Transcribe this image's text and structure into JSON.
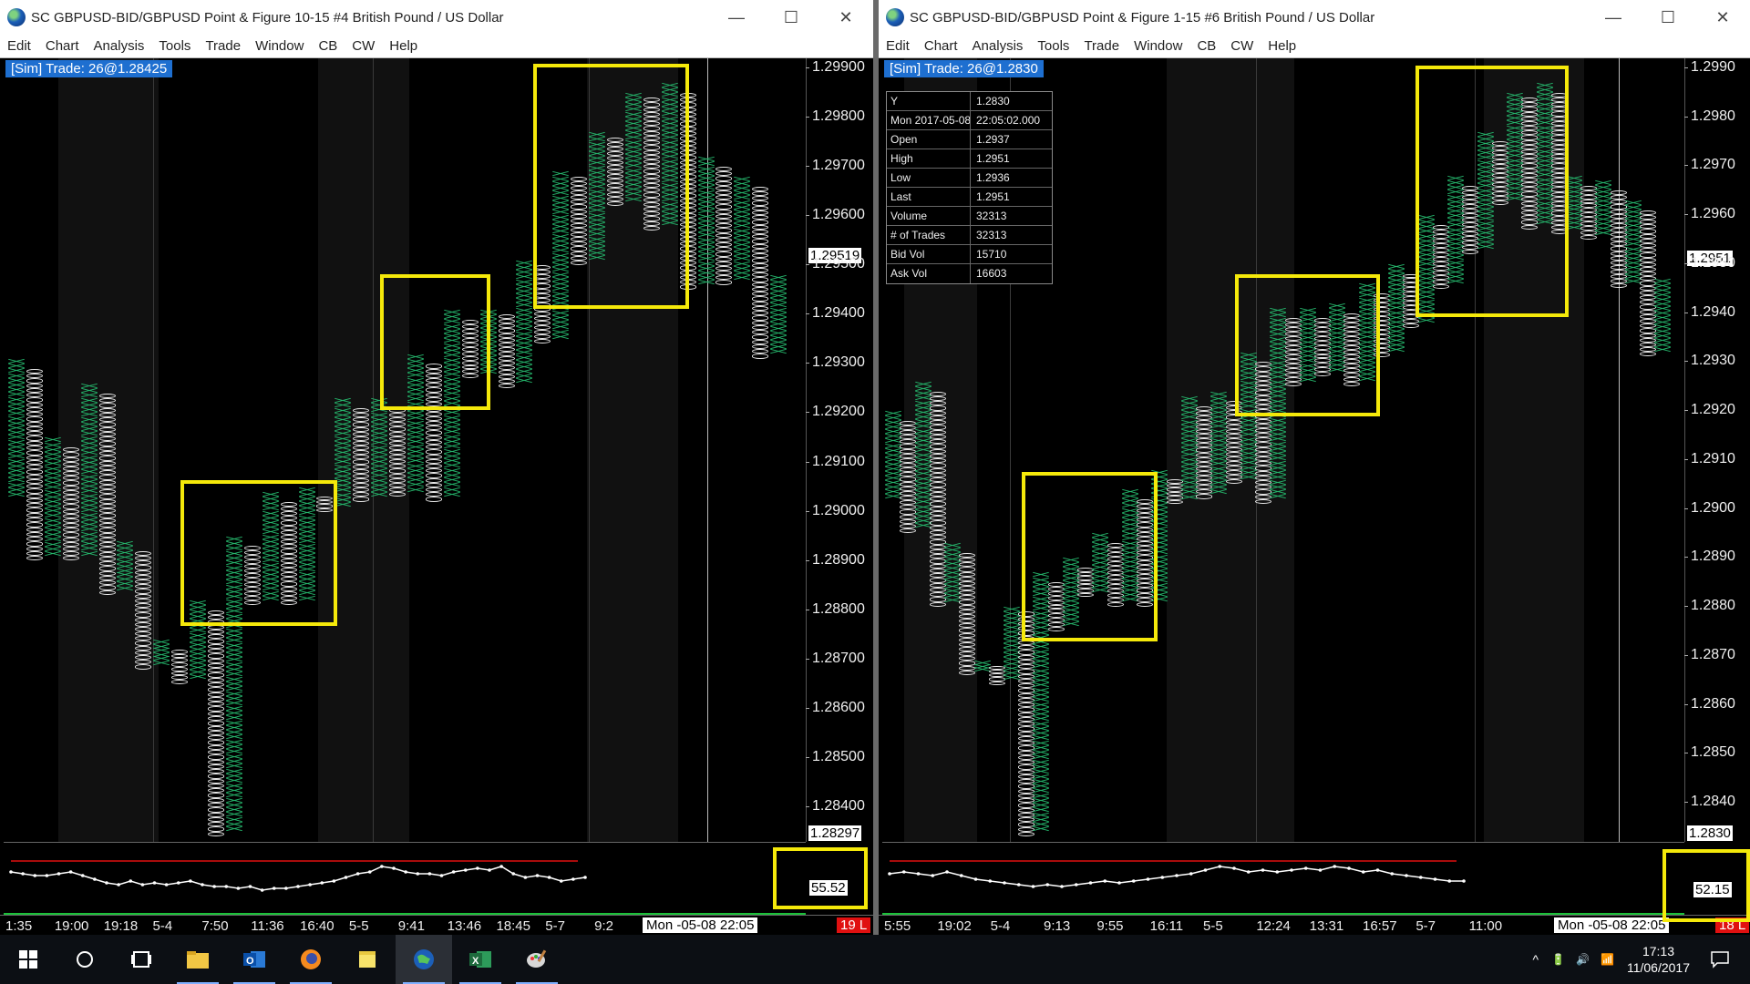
{
  "colors": {
    "x_box": "#25b56b",
    "o_box": "#e8e8e8",
    "highlight": "#f5e90a",
    "sim_label_bg": "#1e6fd0",
    "osc_upper_line": "#e01010",
    "osc_lower_line": "#1cc13a"
  },
  "icons": {
    "title_app_icon": "globe-icon",
    "minimize": "minimize-icon",
    "maximize": "maximize-icon",
    "close": "close-icon"
  },
  "menu": [
    "Edit",
    "Chart",
    "Analysis",
    "Tools",
    "Trade",
    "Window",
    "CB",
    "CW",
    "Help"
  ],
  "title_controls": {
    "minimize": "—",
    "maximize": "☐",
    "close": "✕"
  },
  "windows": {
    "left": {
      "title": "SC GBPUSD-BID/GBPUSD  Point & Figure 10-15  #4  British Pound / US Dollar",
      "sim_label": "[Sim]  Trade: 26@1.28425",
      "price_ticks": [
        "1.29900",
        "1.29800",
        "1.29700",
        "1.29600",
        "1.29500",
        "1.29400",
        "1.29300",
        "1.29200",
        "1.29100",
        "1.29000",
        "1.28900",
        "1.28800",
        "1.28700",
        "1.28600",
        "1.28500",
        "1.28400"
      ],
      "current_price": "1.29519",
      "last_price": "1.28297",
      "osc_value": "55.52",
      "time_labels": [
        "1:35",
        "19:00",
        "19:18",
        "5-4",
        "7:50",
        "11:36",
        "16:40",
        "5-5",
        "9:41",
        "13:46",
        "18:45",
        "5-7",
        "9:2"
      ],
      "date_info": "Mon -05-08  22:05",
      "bars_badge": "19 L"
    },
    "right": {
      "title": "SC GBPUSD-BID/GBPUSD  Point & Figure 1-15  #6  British Pound / US Dollar",
      "sim_label": "[Sim]  Trade: 26@1.2830",
      "price_ticks": [
        "1.2990",
        "1.2980",
        "1.2970",
        "1.2960",
        "1.2950",
        "1.2940",
        "1.2930",
        "1.2920",
        "1.2910",
        "1.2900",
        "1.2890",
        "1.2880",
        "1.2870",
        "1.2860",
        "1.2850",
        "1.2840"
      ],
      "current_price": "1.2951",
      "last_price": "1.2830",
      "osc_value": "52.15",
      "time_labels": [
        "5:55",
        "19:02",
        "5-4",
        "9:13",
        "9:55",
        "16:11",
        "5-5",
        "12:24",
        "13:31",
        "16:57",
        "5-7",
        "11:00"
      ],
      "date_info": "Mon -05-08  22:05",
      "bars_badge": "18 L",
      "data_window": [
        {
          "k": "Y",
          "v": "1.2830"
        },
        {
          "k": "Mon 2017-05-08",
          "v": "22:05:02.000"
        },
        {
          "k": "Open",
          "v": "1.2937"
        },
        {
          "k": "High",
          "v": "1.2951"
        },
        {
          "k": "Low",
          "v": "1.2936"
        },
        {
          "k": "Last",
          "v": "1.2951"
        },
        {
          "k": "Volume",
          "v": "32313"
        },
        {
          "k": "# of Trades",
          "v": "32313"
        },
        {
          "k": "Bid Vol",
          "v": "15710"
        },
        {
          "k": "Ask Vol",
          "v": "16603"
        }
      ]
    }
  },
  "chart_data": [
    {
      "type": "point-and-figure",
      "box_size": 0.0001,
      "ylim": [
        1.2833,
        1.2992
      ],
      "columns": [
        {
          "t": "X",
          "lo": 1.2903,
          "hi": 1.2931
        },
        {
          "t": "O",
          "lo": 1.289,
          "hi": 1.2929
        },
        {
          "t": "X",
          "lo": 1.2891,
          "hi": 1.2915
        },
        {
          "t": "O",
          "lo": 1.289,
          "hi": 1.2913
        },
        {
          "t": "X",
          "lo": 1.2891,
          "hi": 1.2926
        },
        {
          "t": "O",
          "lo": 1.2883,
          "hi": 1.2924
        },
        {
          "t": "X",
          "lo": 1.2884,
          "hi": 1.2894
        },
        {
          "t": "O",
          "lo": 1.2868,
          "hi": 1.2892
        },
        {
          "t": "X",
          "lo": 1.2869,
          "hi": 1.2874
        },
        {
          "t": "O",
          "lo": 1.2865,
          "hi": 1.2872
        },
        {
          "t": "X",
          "lo": 1.2866,
          "hi": 1.2882
        },
        {
          "t": "O",
          "lo": 1.2834,
          "hi": 1.288
        },
        {
          "t": "X",
          "lo": 1.2835,
          "hi": 1.2895
        },
        {
          "t": "O",
          "lo": 1.2881,
          "hi": 1.2893
        },
        {
          "t": "X",
          "lo": 1.2882,
          "hi": 1.2904
        },
        {
          "t": "O",
          "lo": 1.2881,
          "hi": 1.2902
        },
        {
          "t": "X",
          "lo": 1.2882,
          "hi": 1.2905
        },
        {
          "t": "O",
          "lo": 1.29,
          "hi": 1.2903
        },
        {
          "t": "X",
          "lo": 1.2901,
          "hi": 1.2923
        },
        {
          "t": "O",
          "lo": 1.2902,
          "hi": 1.2921
        },
        {
          "t": "X",
          "lo": 1.2903,
          "hi": 1.2923
        },
        {
          "t": "O",
          "lo": 1.2903,
          "hi": 1.2921
        },
        {
          "t": "X",
          "lo": 1.2904,
          "hi": 1.2932
        },
        {
          "t": "O",
          "lo": 1.2902,
          "hi": 1.293
        },
        {
          "t": "X",
          "lo": 1.2903,
          "hi": 1.2941
        },
        {
          "t": "O",
          "lo": 1.2927,
          "hi": 1.2939
        },
        {
          "t": "X",
          "lo": 1.2928,
          "hi": 1.2941
        },
        {
          "t": "O",
          "lo": 1.2925,
          "hi": 1.294
        },
        {
          "t": "X",
          "lo": 1.2926,
          "hi": 1.2951
        },
        {
          "t": "O",
          "lo": 1.2934,
          "hi": 1.295
        },
        {
          "t": "X",
          "lo": 1.2935,
          "hi": 1.2969
        },
        {
          "t": "O",
          "lo": 1.295,
          "hi": 1.2968
        },
        {
          "t": "X",
          "lo": 1.2951,
          "hi": 1.2977
        },
        {
          "t": "O",
          "lo": 1.2962,
          "hi": 1.2976
        },
        {
          "t": "X",
          "lo": 1.2963,
          "hi": 1.2985
        },
        {
          "t": "O",
          "lo": 1.2957,
          "hi": 1.2984
        },
        {
          "t": "X",
          "lo": 1.2958,
          "hi": 1.2987
        },
        {
          "t": "O",
          "lo": 1.2945,
          "hi": 1.2985
        },
        {
          "t": "X",
          "lo": 1.2946,
          "hi": 1.2972
        },
        {
          "t": "O",
          "lo": 1.2946,
          "hi": 1.297
        },
        {
          "t": "X",
          "lo": 1.2947,
          "hi": 1.2968
        },
        {
          "t": "O",
          "lo": 1.2931,
          "hi": 1.2966
        },
        {
          "t": "X",
          "lo": 1.2932,
          "hi": 1.2948
        }
      ],
      "oscillator": {
        "values": [
          52,
          51,
          50,
          50,
          51,
          52,
          50,
          48,
          46,
          45,
          47,
          45,
          46,
          45,
          46,
          47,
          45,
          44,
          44,
          43,
          44,
          42,
          43,
          43,
          44,
          45,
          46,
          47,
          49,
          51,
          52,
          55,
          54,
          52,
          51,
          51,
          50,
          52,
          53,
          54,
          53,
          55,
          51,
          49,
          50,
          49,
          47,
          48,
          49
        ],
        "upper_level": 58,
        "lower_level": 0
      }
    },
    {
      "type": "point-and-figure",
      "box_size": 0.0001,
      "ylim": [
        1.2832,
        1.2992
      ],
      "columns": [
        {
          "t": "X",
          "lo": 1.2902,
          "hi": 1.292
        },
        {
          "t": "O",
          "lo": 1.2895,
          "hi": 1.2918
        },
        {
          "t": "X",
          "lo": 1.2896,
          "hi": 1.2926
        },
        {
          "t": "O",
          "lo": 1.288,
          "hi": 1.2924
        },
        {
          "t": "X",
          "lo": 1.2881,
          "hi": 1.2893
        },
        {
          "t": "O",
          "lo": 1.2866,
          "hi": 1.2891
        },
        {
          "t": "X",
          "lo": 1.2867,
          "hi": 1.2869
        },
        {
          "t": "O",
          "lo": 1.2864,
          "hi": 1.2868
        },
        {
          "t": "X",
          "lo": 1.2865,
          "hi": 1.288
        },
        {
          "t": "O",
          "lo": 1.2833,
          "hi": 1.2879
        },
        {
          "t": "X",
          "lo": 1.2834,
          "hi": 1.2887
        },
        {
          "t": "O",
          "lo": 1.2875,
          "hi": 1.2885
        },
        {
          "t": "X",
          "lo": 1.2876,
          "hi": 1.289
        },
        {
          "t": "O",
          "lo": 1.2882,
          "hi": 1.2888
        },
        {
          "t": "X",
          "lo": 1.2883,
          "hi": 1.2895
        },
        {
          "t": "O",
          "lo": 1.288,
          "hi": 1.2893
        },
        {
          "t": "X",
          "lo": 1.2881,
          "hi": 1.2904
        },
        {
          "t": "O",
          "lo": 1.288,
          "hi": 1.2902
        },
        {
          "t": "X",
          "lo": 1.2881,
          "hi": 1.2908
        },
        {
          "t": "O",
          "lo": 1.2901,
          "hi": 1.2906
        },
        {
          "t": "X",
          "lo": 1.2902,
          "hi": 1.2923
        },
        {
          "t": "O",
          "lo": 1.2902,
          "hi": 1.2921
        },
        {
          "t": "X",
          "lo": 1.2903,
          "hi": 1.2924
        },
        {
          "t": "O",
          "lo": 1.2905,
          "hi": 1.2922
        },
        {
          "t": "X",
          "lo": 1.2906,
          "hi": 1.2932
        },
        {
          "t": "O",
          "lo": 1.2901,
          "hi": 1.293
        },
        {
          "t": "X",
          "lo": 1.2902,
          "hi": 1.2941
        },
        {
          "t": "O",
          "lo": 1.2925,
          "hi": 1.2939
        },
        {
          "t": "X",
          "lo": 1.2926,
          "hi": 1.2941
        },
        {
          "t": "O",
          "lo": 1.2927,
          "hi": 1.2939
        },
        {
          "t": "X",
          "lo": 1.2928,
          "hi": 1.2942
        },
        {
          "t": "O",
          "lo": 1.2925,
          "hi": 1.294
        },
        {
          "t": "X",
          "lo": 1.2926,
          "hi": 1.2946
        },
        {
          "t": "O",
          "lo": 1.2931,
          "hi": 1.2944
        },
        {
          "t": "X",
          "lo": 1.2932,
          "hi": 1.295
        },
        {
          "t": "O",
          "lo": 1.2937,
          "hi": 1.2948
        },
        {
          "t": "X",
          "lo": 1.2938,
          "hi": 1.296
        },
        {
          "t": "O",
          "lo": 1.2945,
          "hi": 1.2958
        },
        {
          "t": "X",
          "lo": 1.2946,
          "hi": 1.2968
        },
        {
          "t": "O",
          "lo": 1.2952,
          "hi": 1.2966
        },
        {
          "t": "X",
          "lo": 1.2953,
          "hi": 1.2977
        },
        {
          "t": "O",
          "lo": 1.2962,
          "hi": 1.2975
        },
        {
          "t": "X",
          "lo": 1.2963,
          "hi": 1.2985
        },
        {
          "t": "O",
          "lo": 1.2957,
          "hi": 1.2984
        },
        {
          "t": "X",
          "lo": 1.2958,
          "hi": 1.2987
        },
        {
          "t": "O",
          "lo": 1.2956,
          "hi": 1.2985
        },
        {
          "t": "X",
          "lo": 1.2957,
          "hi": 1.2968
        },
        {
          "t": "O",
          "lo": 1.2955,
          "hi": 1.2966
        },
        {
          "t": "X",
          "lo": 1.2956,
          "hi": 1.2967
        },
        {
          "t": "O",
          "lo": 1.2945,
          "hi": 1.2965
        },
        {
          "t": "X",
          "lo": 1.2946,
          "hi": 1.2963
        },
        {
          "t": "O",
          "lo": 1.2931,
          "hi": 1.2961
        },
        {
          "t": "X",
          "lo": 1.2932,
          "hi": 1.2947
        }
      ],
      "oscillator": {
        "values": [
          51,
          52,
          51,
          50,
          52,
          50,
          48,
          47,
          46,
          45,
          44,
          45,
          44,
          45,
          46,
          47,
          46,
          47,
          48,
          49,
          50,
          51,
          53,
          55,
          54,
          52,
          53,
          52,
          53,
          54,
          53,
          55,
          54,
          52,
          53,
          51,
          50,
          49,
          48,
          47,
          47
        ],
        "upper_level": 58,
        "lower_level": 0
      }
    }
  ],
  "taskbar": {
    "icons": [
      "windows-start-icon",
      "search-circle-icon",
      "task-view-icon",
      "file-explorer-icon",
      "outlook-icon",
      "firefox-icon",
      "sticky-notes-icon",
      "sierra-chart-icon",
      "excel-icon",
      "paint-icon"
    ],
    "active_icon": "sierra-chart-icon",
    "tray_symbols": [
      "^",
      "🔋",
      "🔊",
      "📶"
    ],
    "time": "17:13",
    "date": "11/06/2017",
    "notification_icon": "notification-icon"
  }
}
